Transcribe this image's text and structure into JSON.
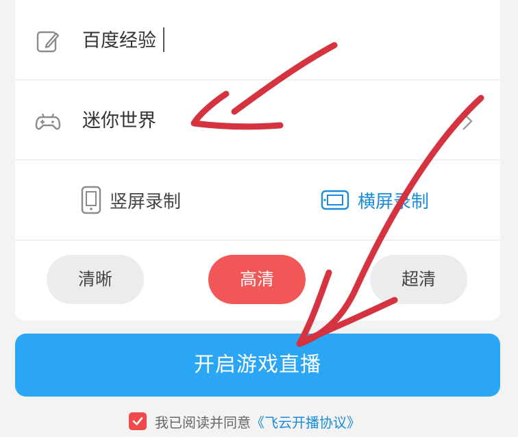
{
  "title_field": {
    "value": "百度经验",
    "icon": "edit-icon"
  },
  "game_field": {
    "value": "迷你世界",
    "icon": "gamepad-icon",
    "chevron": "chevron-right-icon"
  },
  "orientation": {
    "portrait_label": "竖屏录制",
    "landscape_label": "横屏录制",
    "selected": "landscape"
  },
  "quality": {
    "options": [
      "清晰",
      "高清",
      "超清"
    ],
    "selected": "高清"
  },
  "start_button": {
    "label": "开启游戏直播"
  },
  "agreement": {
    "checked": true,
    "text": "我已阅读并同意",
    "link": "《飞云开播协议》"
  },
  "colors": {
    "accent_blue": "#2aa6f5",
    "link_blue": "#1a8bd8",
    "selected_red": "#f25757",
    "checkbox_red": "#ef4b4b",
    "annotation_red": "#d4333f"
  }
}
